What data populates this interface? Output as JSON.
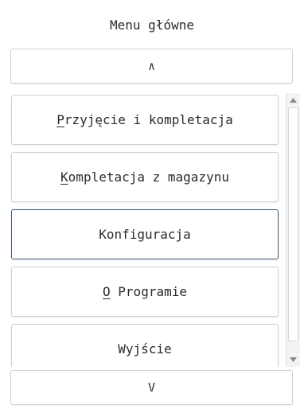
{
  "menu": {
    "title": "Menu główne",
    "up_label": "∧",
    "down_label": "V",
    "items": [
      {
        "mnemonic": "P",
        "rest": "rzyjęcie i kompletacja"
      },
      {
        "mnemonic": "K",
        "rest": "ompletacja z magazynu"
      },
      {
        "mnemonic": "",
        "rest": "Konfiguracja"
      },
      {
        "mnemonic": "O",
        "rest": " Programie"
      },
      {
        "mnemonic": "",
        "rest": "Wyjście"
      }
    ],
    "focused_index": 2
  },
  "icons": {
    "scroll_up": "triangle-up-icon",
    "scroll_down": "triangle-down-icon"
  },
  "colors": {
    "focus_border": "#3d5a7a",
    "button_border": "#cfcfcf",
    "scrollbar_track": "#f3f3f3"
  }
}
